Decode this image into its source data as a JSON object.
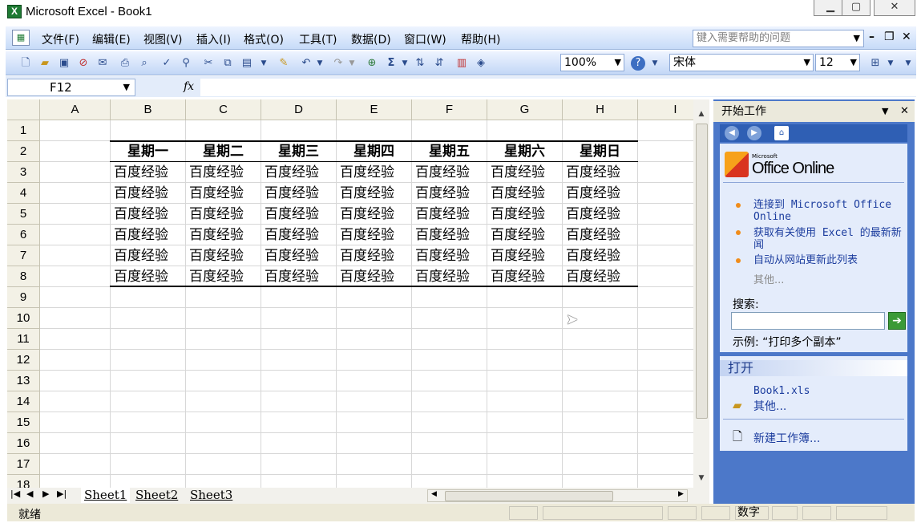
{
  "window": {
    "title": "Microsoft Excel - Book1",
    "app_icon": "X"
  },
  "menubar": {
    "items": [
      "文件(F)",
      "编辑(E)",
      "视图(V)",
      "插入(I)",
      "格式(O)",
      "工具(T)",
      "数据(D)",
      "窗口(W)",
      "帮助(H)"
    ],
    "help_placeholder": "键入需要帮助的问题"
  },
  "toolbar": {
    "zoom": "100%",
    "font_name": "宋体",
    "font_size": "12"
  },
  "formula": {
    "name_box": "F12",
    "fx_label": "fx",
    "content": ""
  },
  "sheet": {
    "columns": [
      "A",
      "B",
      "C",
      "D",
      "E",
      "F",
      "G",
      "H",
      "I"
    ],
    "rows": [
      "1",
      "2",
      "3",
      "4",
      "5",
      "6",
      "7",
      "8",
      "9",
      "10",
      "11",
      "12",
      "13",
      "14",
      "15",
      "16",
      "17",
      "18"
    ],
    "table_header": [
      "星期一",
      "星期二",
      "星期三",
      "星期四",
      "星期五",
      "星期六",
      "星期日"
    ],
    "table_rows": [
      [
        "百度经验",
        "百度经验",
        "百度经验",
        "百度经验",
        "百度经验",
        "百度经验",
        "百度经验"
      ],
      [
        "百度经验",
        "百度经验",
        "百度经验",
        "百度经验",
        "百度经验",
        "百度经验",
        "百度经验"
      ],
      [
        "百度经验",
        "百度经验",
        "百度经验",
        "百度经验",
        "百度经验",
        "百度经验",
        "百度经验"
      ],
      [
        "百度经验",
        "百度经验",
        "百度经验",
        "百度经验",
        "百度经验",
        "百度经验",
        "百度经验"
      ],
      [
        "百度经验",
        "百度经验",
        "百度经验",
        "百度经验",
        "百度经验",
        "百度经验",
        "百度经验"
      ],
      [
        "百度经验",
        "百度经验",
        "百度经验",
        "百度经验",
        "百度经验",
        "百度经验",
        "百度经验"
      ]
    ]
  },
  "tabs": [
    "Sheet1",
    "Sheet2",
    "Sheet3"
  ],
  "status": {
    "ready": "就绪",
    "num_indicator": "数字"
  },
  "taskpane": {
    "title": "开始工作",
    "logo_small": "Microsoft",
    "logo": "Office Online",
    "links": [
      "连接到 Microsoft Office Online",
      "获取有关使用 Excel 的最新新闻",
      "自动从网站更新此列表"
    ],
    "more": "其他...",
    "search_label": "搜索:",
    "search_example": "示例: “打印多个副本”",
    "open_title": "打开",
    "open_file": "Book1.xls",
    "open_more": "其他...",
    "new_workbook": "新建工作簿..."
  },
  "colors": {
    "accent": "#4c78c9",
    "header_bg": "#f3f1e6",
    "toolbar": "#c7dbf8"
  }
}
